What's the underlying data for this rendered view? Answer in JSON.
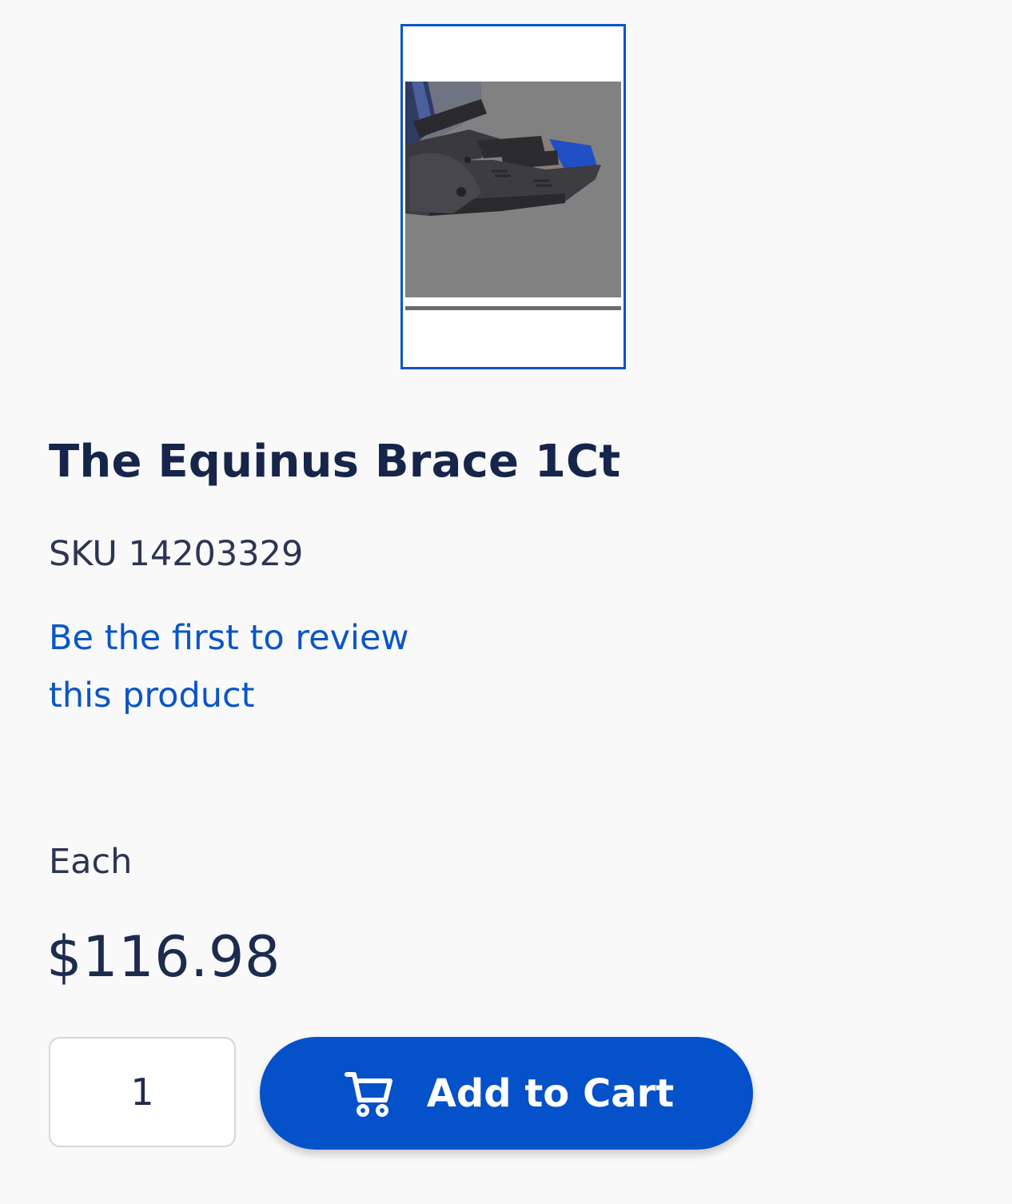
{
  "product": {
    "thumbnail_label": "The Equinus Brace 1Ct product thumbnail",
    "title": "The Equinus Brace 1Ct",
    "sku": "SKU 14203329",
    "review_link": "Be the first to review this product",
    "unit": "Each",
    "price": "$116.98"
  },
  "purchase": {
    "quantity_value": "1",
    "add_to_cart_label": "Add to Cart",
    "cart_icon": "cart-icon"
  },
  "colors": {
    "accent": "#0451c9",
    "link": "#0a55c8",
    "text": "#1d2b4f"
  }
}
